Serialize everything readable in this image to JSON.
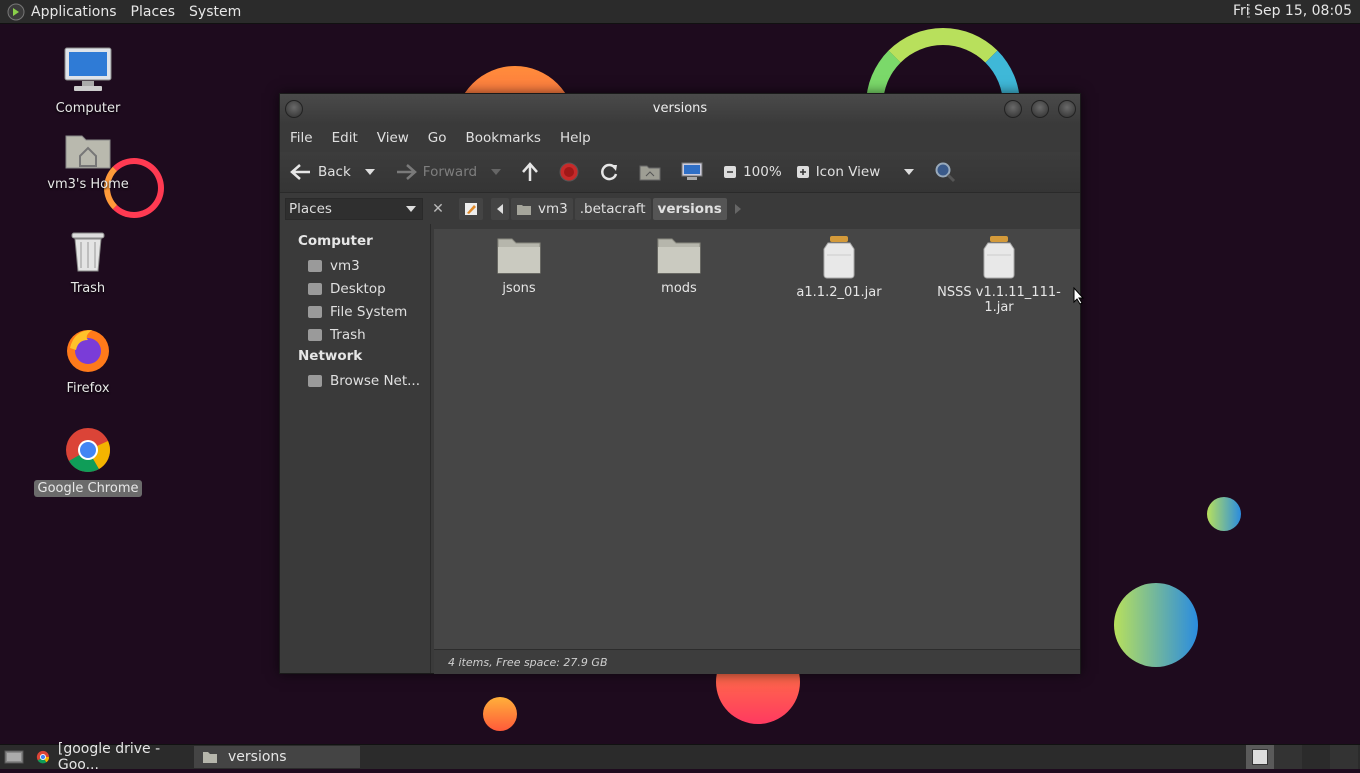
{
  "topbar": {
    "menu": [
      "Applications",
      "Places",
      "System"
    ],
    "clock": "Fri Sep 15, 08:05"
  },
  "desktop": {
    "icons": [
      {
        "label": "Computer",
        "icon": "computer-icon"
      },
      {
        "label": "vm3's Home",
        "icon": "home-folder-icon"
      },
      {
        "label": "Trash",
        "icon": "trash-icon"
      },
      {
        "label": "Firefox",
        "icon": "firefox-icon"
      },
      {
        "label": "Google Chrome",
        "icon": "chrome-icon",
        "selected": true
      }
    ]
  },
  "window": {
    "title": "versions",
    "menu": [
      "File",
      "Edit",
      "View",
      "Go",
      "Bookmarks",
      "Help"
    ],
    "toolbar": {
      "back": "Back",
      "forward": "Forward",
      "zoom": "100%",
      "view_mode": "Icon View"
    },
    "sidebar": {
      "selector": "Places",
      "sections": [
        {
          "title": "Computer",
          "items": [
            "vm3",
            "Desktop",
            "File System",
            "Trash"
          ]
        },
        {
          "title": "Network",
          "items": [
            "Browse Net..."
          ]
        }
      ]
    },
    "path": [
      "vm3",
      ".betacraft",
      "versions"
    ],
    "files": [
      {
        "name": "jsons",
        "type": "folder"
      },
      {
        "name": "mods",
        "type": "folder"
      },
      {
        "name": "a1.1.2_01.jar",
        "type": "jar"
      },
      {
        "name": "NSSS v1.1.11_111-1.jar",
        "type": "jar"
      }
    ],
    "status": "4 items, Free space: 27.9 GB"
  },
  "taskbar": {
    "tasks": [
      {
        "label": "[google drive - Goo...",
        "icon": "chrome-icon"
      },
      {
        "label": "versions",
        "icon": "folder-icon",
        "active": true
      }
    ]
  },
  "colors": {
    "desktop_bg": "#1e0b1e",
    "panel_bg": "#2b2b2b",
    "window_bg": "#3a3a3a",
    "content_bg": "#464646"
  }
}
